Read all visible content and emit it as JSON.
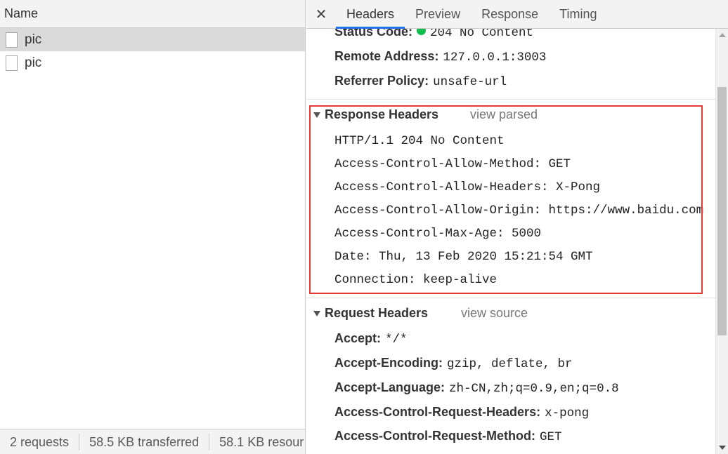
{
  "left_panel": {
    "column_header": "Name",
    "requests": [
      {
        "name": "pic",
        "selected": true
      },
      {
        "name": "pic",
        "selected": false
      }
    ],
    "status_bar": [
      "2 requests",
      "58.5 KB transferred",
      "58.1 KB resour"
    ]
  },
  "tabs": {
    "close": "✕",
    "items": [
      "Headers",
      "Preview",
      "Response",
      "Timing"
    ],
    "active": "Headers"
  },
  "general": {
    "status_code_label": "Status Code:",
    "status_code_value": "204 No Content",
    "status_color": "#0fbd4e",
    "remote_address_label": "Remote Address:",
    "remote_address_value": "127.0.0.1:3003",
    "referrer_policy_label": "Referrer Policy:",
    "referrer_policy_value": "unsafe-url"
  },
  "response_headers": {
    "title": "Response Headers",
    "view_link": "view parsed",
    "lines": [
      "HTTP/1.1 204 No Content",
      "Access-Control-Allow-Method: GET",
      "Access-Control-Allow-Headers: X-Pong",
      "Access-Control-Allow-Origin: https://www.baidu.com",
      "Access-Control-Max-Age: 5000",
      "Date: Thu, 13 Feb 2020 15:21:54 GMT",
      "Connection: keep-alive"
    ],
    "highlight_color": "#e53935"
  },
  "request_headers": {
    "title": "Request Headers",
    "view_link": "view source",
    "items": [
      {
        "key": "Accept:",
        "value": "*/*"
      },
      {
        "key": "Accept-Encoding:",
        "value": "gzip, deflate, br"
      },
      {
        "key": "Accept-Language:",
        "value": "zh-CN,zh;q=0.9,en;q=0.8"
      },
      {
        "key": "Access-Control-Request-Headers:",
        "value": "x-pong"
      },
      {
        "key": "Access-Control-Request-Method:",
        "value": "GET"
      }
    ]
  }
}
